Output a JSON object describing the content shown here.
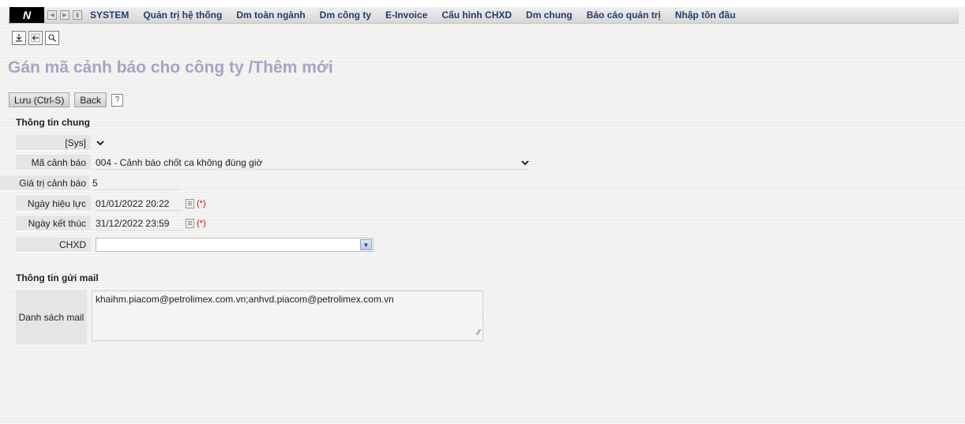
{
  "menu": {
    "logo": "N",
    "items": [
      "SYSTEM",
      "Quản trị hệ thống",
      "Dm toàn ngành",
      "Dm công ty",
      "E-Invoice",
      "Cấu hình CHXD",
      "Dm chung",
      "Báo cáo quản trị",
      "Nhập tồn đầu"
    ]
  },
  "toolbar_icons": [
    "download-icon",
    "back-arrow-icon",
    "zoom-icon"
  ],
  "page": {
    "title": "Gán mã cảnh báo cho công ty /Thêm mới"
  },
  "actions": {
    "save_label": "Lưu (Ctrl-S)",
    "back_label": "Back",
    "help_label": "?"
  },
  "general": {
    "section_title": "Thông tin chung",
    "sys_label": "[Sys]",
    "warning_code_label": "Mã cảnh báo",
    "warning_code_value": "004 - Cảnh báo chốt ca không đúng giờ",
    "warning_value_label": "Giá trị cảnh báo",
    "warning_value": "5",
    "effective_date_label": "Ngày hiệu lực",
    "effective_date_value": "01/01/2022 20:22",
    "end_date_label": "Ngày kết thúc",
    "end_date_value": "31/12/2022 23:59",
    "required_mark": "(*)",
    "chxd_label": "CHXD",
    "chxd_value": ""
  },
  "mail": {
    "section_title": "Thông tin gửi mail",
    "list_label": "Danh sách mail",
    "list_value": "khaihm.piacom@petrolimex.com.vn;anhvd.piacom@petrolimex.com.vn"
  }
}
